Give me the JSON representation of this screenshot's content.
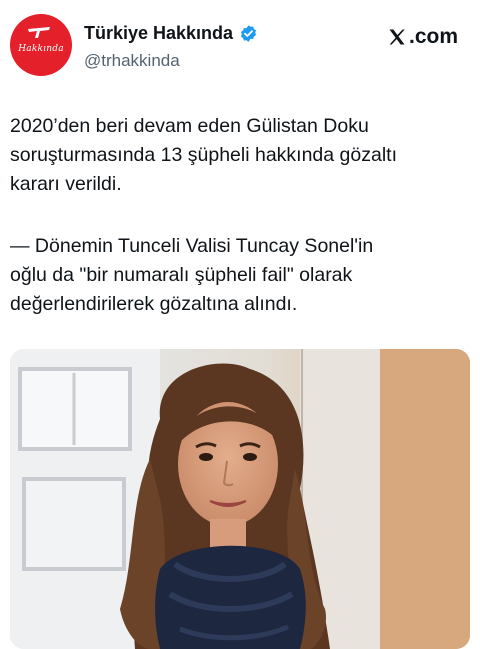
{
  "account": {
    "display_name": "Türkiye Hakkında",
    "handle": "@trhakkinda",
    "avatar_text": "Hakkında",
    "verified": true
  },
  "brand": {
    "site": ".com",
    "logo_icon": "x-logo-icon"
  },
  "post": {
    "paragraph_1": "2020’den beri devam eden Gülistan Doku\nsoruşturmasında 13 şüpheli hakkında gözaltı\nkararı verildi.",
    "paragraph_2": "— Dönemin Tunceli Valisi Tuncay Sonel'in\noğlu da \"bir numaralı şüpheli fail\" olarak\ndeğerlendirilerek gözaltına alındı."
  },
  "colors": {
    "avatar_bg": "#e4202a",
    "verified": "#1d9bf0",
    "text": "#0f1419",
    "muted": "#536471"
  }
}
